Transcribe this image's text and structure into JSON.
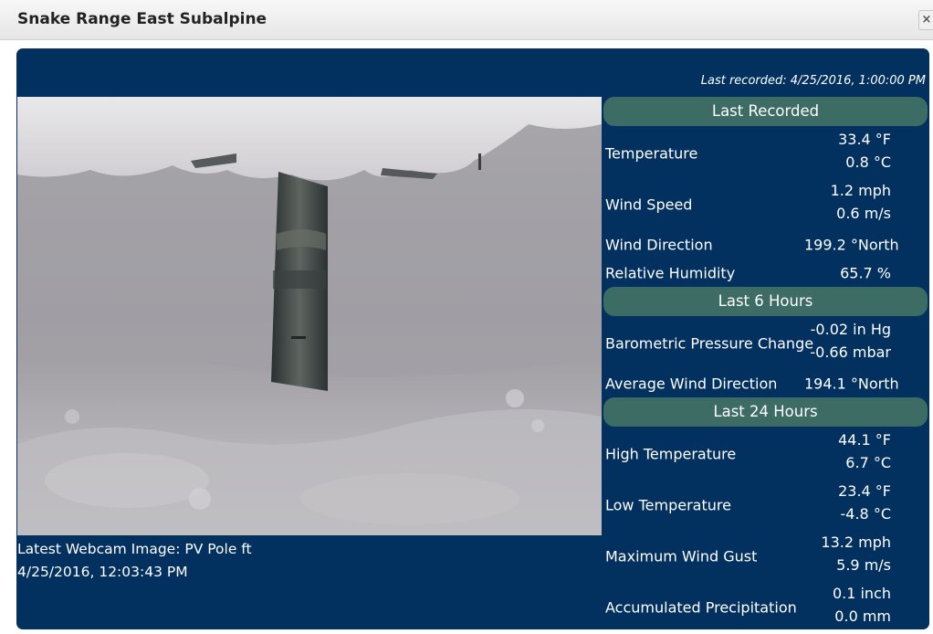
{
  "window": {
    "title": "Snake Range East Subalpine",
    "close_glyph": "×"
  },
  "header": {
    "last_recorded": "Last recorded: 4/25/2016, 1:00:00 PM"
  },
  "webcam": {
    "caption_line1": "Latest Webcam Image: PV Pole ft",
    "caption_line2": "4/25/2016, 12:03:43 PM"
  },
  "sections": [
    {
      "title": "Last Recorded",
      "rows": [
        {
          "label": "Temperature",
          "values": [
            "33.4 °F",
            "0.8 °C"
          ]
        },
        {
          "label": "Wind Speed",
          "values": [
            "1.2 mph",
            "0.6 m/s"
          ]
        },
        {
          "label": "Wind Direction",
          "values": [
            "199.2 °North"
          ]
        },
        {
          "label": "Relative Humidity",
          "values": [
            "65.7 %"
          ]
        }
      ]
    },
    {
      "title": "Last 6 Hours",
      "rows": [
        {
          "label": "Barometric Pressure Change",
          "values": [
            "-0.02 in Hg",
            "-0.66 mbar"
          ]
        },
        {
          "label": "Average Wind Direction",
          "values": [
            "194.1 °North"
          ]
        }
      ]
    },
    {
      "title": "Last 24 Hours",
      "rows": [
        {
          "label": "High Temperature",
          "values": [
            "44.1 °F",
            "6.7 °C"
          ]
        },
        {
          "label": "Low Temperature",
          "values": [
            "23.4 °F",
            "-4.8 °C"
          ]
        },
        {
          "label": "Maximum Wind Gust",
          "values": [
            "13.2 mph",
            "5.9 m/s"
          ]
        },
        {
          "label": "Accumulated Precipitation",
          "values": [
            "0.1 inch",
            "0.0 mm"
          ]
        }
      ]
    }
  ]
}
